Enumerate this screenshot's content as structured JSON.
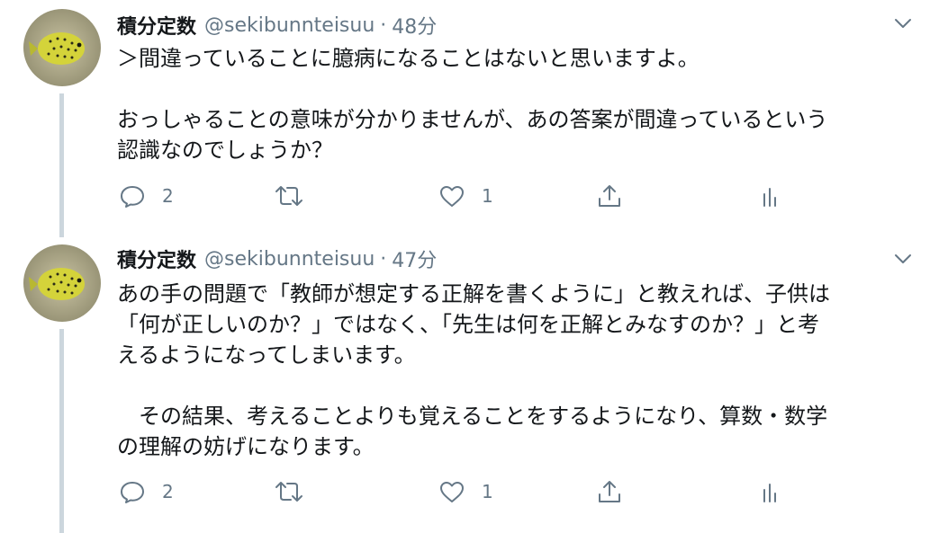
{
  "tweets": [
    {
      "author": {
        "display_name": "積分定数",
        "handle": "@sekibunnteisuu",
        "separator": "·",
        "time": "48分",
        "avatar_icon": "pufferfish-avatar-icon"
      },
      "lines": [
        "＞間違っていることに臆病になることはないと思いますよ。",
        "",
        "おっしゃることの意味が分かりませんが、あの答案が間違っているという",
        "認識なのでしょうか？"
      ],
      "actions": {
        "reply_count": "2",
        "retweet_count": "",
        "like_count": "1"
      }
    },
    {
      "author": {
        "display_name": "積分定数",
        "handle": "@sekibunnteisuu",
        "separator": "·",
        "time": "47分",
        "avatar_icon": "pufferfish-avatar-icon"
      },
      "lines": [
        "あの手の問題で「教師が想定する正解を書くように」と教えれば、子供は",
        "「何が正しいのか？」ではなく、「先生は何を正解とみなすのか？」と考",
        "えるようになってしまいます。",
        "",
        "　その結果、考えることよりも覚えることをするようになり、算数・数学",
        "の理解の妨げになります。"
      ],
      "actions": {
        "reply_count": "2",
        "retweet_count": "",
        "like_count": "1"
      }
    }
  ],
  "icons": {
    "reply": "comment-icon",
    "retweet": "retweet-icon",
    "like": "heart-icon",
    "share": "share-icon",
    "analytics": "analytics-icon",
    "menu": "chevron-down-icon"
  },
  "colors": {
    "text": "#14171a",
    "secondary": "#657786",
    "thread_line": "#ccd6dd",
    "background": "#ffffff"
  }
}
